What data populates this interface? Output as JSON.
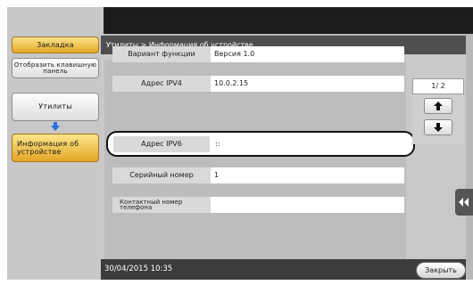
{
  "sidebar": {
    "bookmark_label": "Закладка",
    "keypad_label": "Отобразить клавишную панель",
    "utilities_label": "Утилиты",
    "device_info_label": "Информация об устройстве"
  },
  "breadcrumb": "Утилиты > Информация об устройстве",
  "rows": [
    {
      "label": "Вариант функции",
      "value": "Версия 1.0"
    },
    {
      "label": "Адрес IPV4",
      "value": "10.0.2.15"
    },
    {
      "label": "Адрес IPV6",
      "value": "::"
    },
    {
      "label": "Серийный номер",
      "value": "1"
    },
    {
      "label": "Контактный номер телефона",
      "value": ""
    }
  ],
  "pager": {
    "text": "1/ 2"
  },
  "status": {
    "datetime": "30/04/2015 10:35"
  },
  "close_label": "Закрыть",
  "icons": {
    "up": "arrow-up-icon",
    "down": "arrow-down-icon",
    "flow": "flow-arrow-down-icon",
    "collapse": "double-chevron-left-icon"
  },
  "colors": {
    "accent_orange": "#e3a827",
    "flow_arrow": "#2a6fe0",
    "breadcrumb_bar": "#4f4f4f"
  }
}
